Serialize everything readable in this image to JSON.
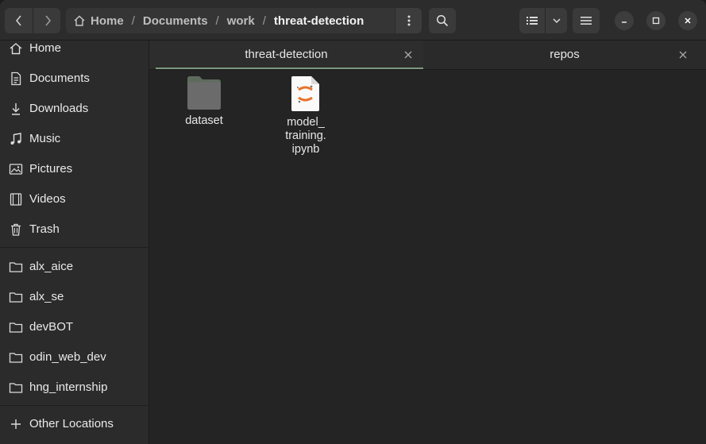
{
  "header": {
    "breadcrumb": [
      "Home",
      "Documents",
      "work",
      "threat-detection"
    ],
    "separator": "/"
  },
  "sidebar": {
    "places": [
      {
        "label": "Home",
        "icon": "home-icon"
      },
      {
        "label": "Documents",
        "icon": "document-icon"
      },
      {
        "label": "Downloads",
        "icon": "download-icon"
      },
      {
        "label": "Music",
        "icon": "music-icon"
      },
      {
        "label": "Pictures",
        "icon": "picture-icon"
      },
      {
        "label": "Videos",
        "icon": "video-icon"
      },
      {
        "label": "Trash",
        "icon": "trash-icon"
      }
    ],
    "bookmarks": [
      {
        "label": "alx_aice",
        "icon": "folder-icon"
      },
      {
        "label": "alx_se",
        "icon": "folder-icon"
      },
      {
        "label": "devBOT",
        "icon": "folder-icon"
      },
      {
        "label": "odin_web_dev",
        "icon": "folder-icon"
      },
      {
        "label": "hng_internship",
        "icon": "folder-icon"
      }
    ],
    "other": {
      "label": "Other Locations",
      "icon": "plus-icon"
    }
  },
  "tabs": [
    {
      "label": "threat-detection",
      "active": true
    },
    {
      "label": "repos",
      "active": false
    }
  ],
  "files": [
    {
      "name": "dataset",
      "type": "folder",
      "icon": "folder-icon"
    },
    {
      "name_lines": [
        "model_",
        "training.",
        "ipynb"
      ],
      "type": "notebook",
      "icon": "jupyter-notebook-icon"
    }
  ],
  "colors": {
    "accent": "#7c9a7f",
    "jupyter_orange": "#e8722a"
  }
}
